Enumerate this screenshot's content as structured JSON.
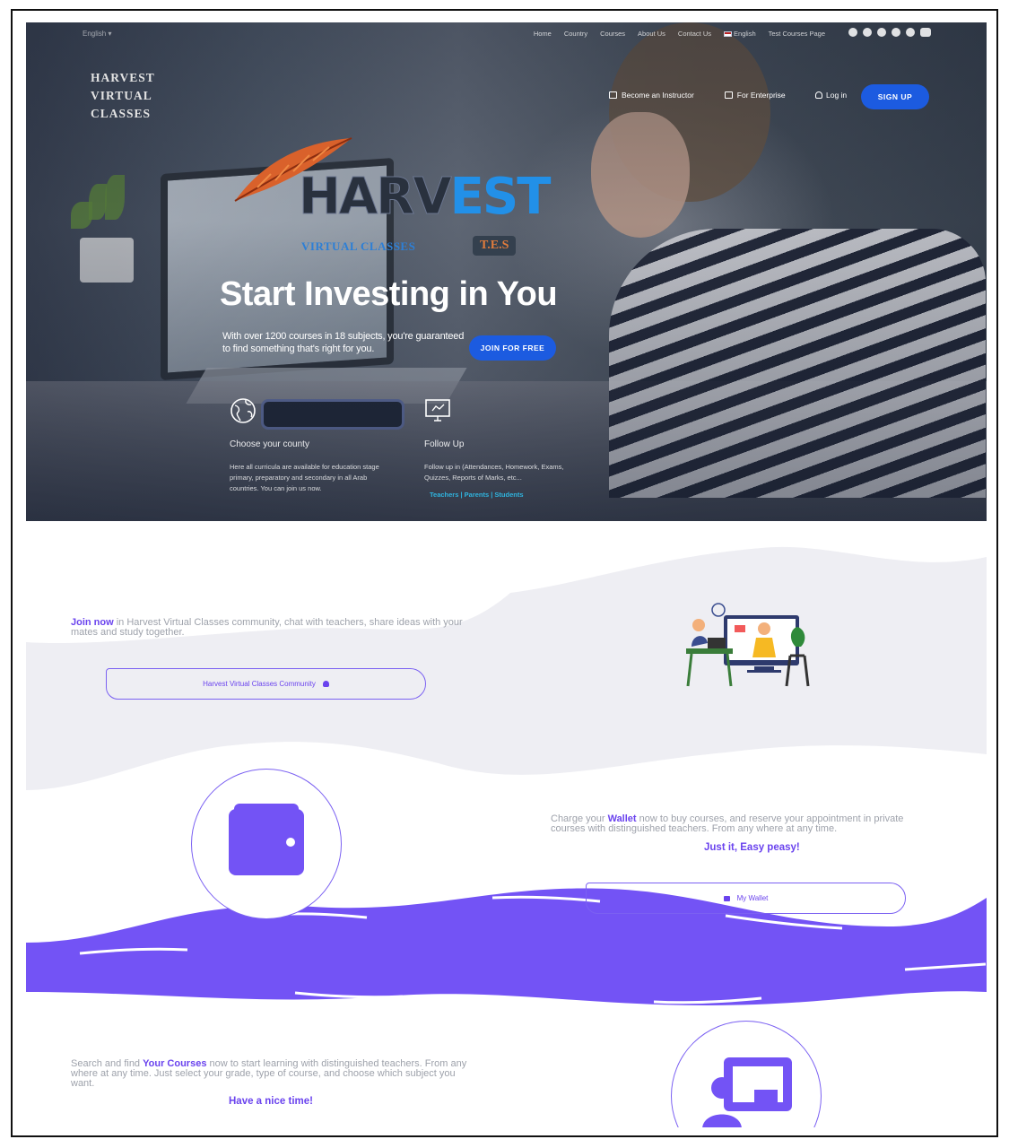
{
  "header": {
    "language_selector": "English ▾",
    "nav": [
      "Home",
      "Country",
      "Courses",
      "About Us",
      "Contact Us",
      "English",
      "Test Courses Page"
    ],
    "socials": [
      "facebook-icon",
      "twitter-icon",
      "instagram-icon",
      "whatsapp-icon",
      "telegram-icon",
      "youtube-icon"
    ],
    "brand_lines": [
      "HARVEST",
      "VIRTUAL",
      "CLASSES"
    ],
    "become_instructor": "Become an Instructor",
    "for_enterprise": "For Enterprise",
    "login": "Log in",
    "signup": "SIGN UP"
  },
  "hero": {
    "logo": {
      "word_left": "HARV",
      "word_right": "EST",
      "subtitle": "VIRTUAL CLASSES",
      "badge": "T.E.S"
    },
    "headline": "Start Investing in You",
    "subtext": "With over 1200 courses in 18 subjects, you're guaranteed to find something that's right for you.",
    "cta": "JOIN FOR FREE",
    "features": [
      {
        "icon": "globe-icon",
        "title": "Choose your county",
        "description": "Here all curricula are available for education stage primary, preparatory and secondary in all Arab countries. You can join us now."
      },
      {
        "icon": "monitor-icon",
        "title": "Follow Up",
        "description": "Follow up in (Attendances, Homework, Exams, Quizzes, Reports of Marks, etc...",
        "links": "Teachers | Parents | Students"
      }
    ]
  },
  "community": {
    "highlight": "Join now",
    "text": " in Harvest Virtual Classes community, chat with teachers, share ideas with your mates and study together.",
    "button": "Harvest Virtual Classes Community"
  },
  "wallet": {
    "pre": "Charge your ",
    "highlight": "Wallet",
    "text": " now to buy courses, and reserve your appointment in private courses with distinguished teachers. From any where at any time.",
    "tagline": "Just it, Easy peasy!",
    "button": "My Wallet"
  },
  "courses": {
    "pre": "Search and find ",
    "highlight": "Your Courses",
    "text": " now to start learning with distinguished teachers. From any where at any time. Just select your grade, type of course, and choose which subject you want.",
    "tagline": "Have a nice time!"
  },
  "colors": {
    "accent": "#6a43ee",
    "primary_button": "#1c5be0",
    "wave": "#7353f5",
    "teal_link": "#2fb5e0"
  }
}
